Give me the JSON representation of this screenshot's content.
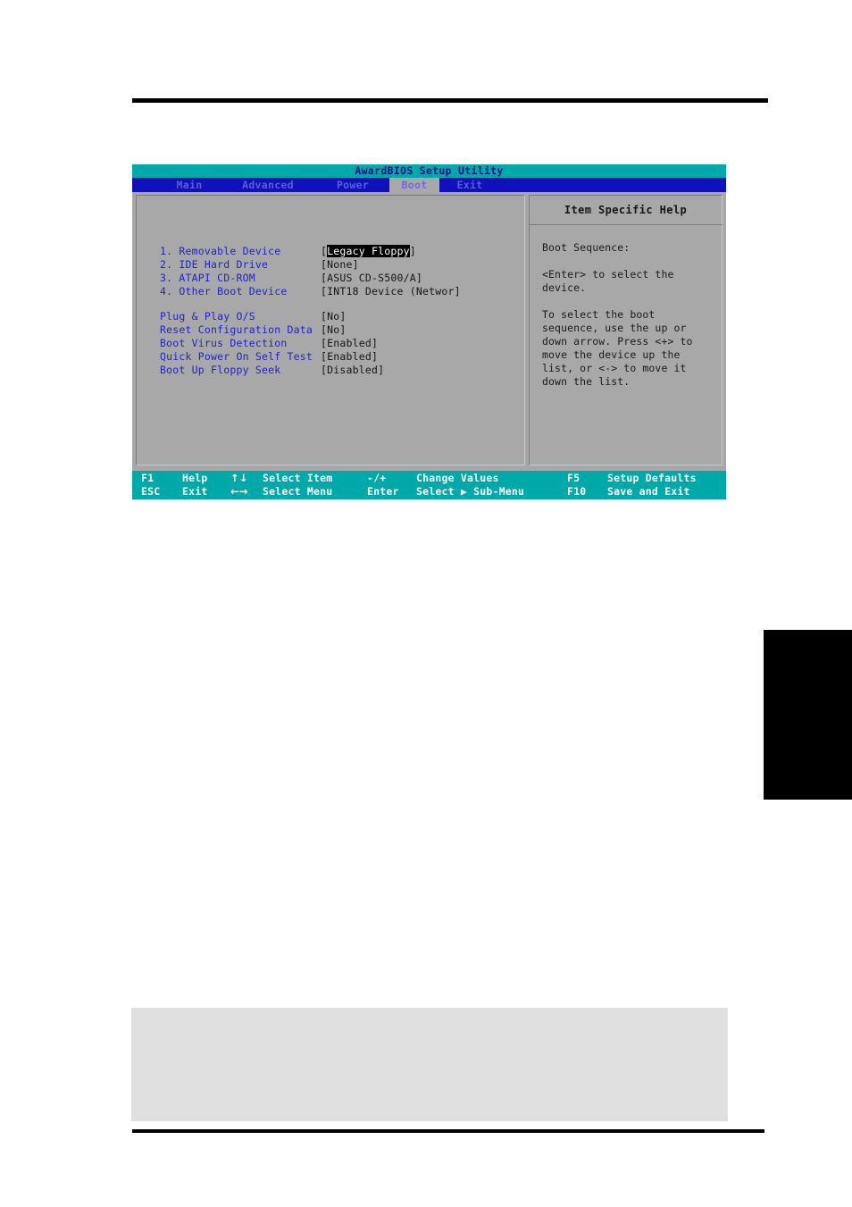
{
  "bios": {
    "title": "AwardBIOS Setup Utility",
    "tabs": [
      {
        "label": "Main",
        "active": false
      },
      {
        "label": "Advanced",
        "active": false
      },
      {
        "label": "Power",
        "active": false
      },
      {
        "label": "Boot",
        "active": true
      },
      {
        "label": "Exit",
        "active": false
      }
    ],
    "boot_sequence": [
      {
        "label": "1. Removable Device",
        "value_open": "[",
        "value_highlight": "Legacy Floppy",
        "value_plain": "",
        "value_close": "]"
      },
      {
        "label": "2. IDE Hard Drive",
        "value": "[None]"
      },
      {
        "label": "3. ATAPI CD-ROM",
        "value": "[ASUS CD-S500/A]"
      },
      {
        "label": "4. Other Boot Device",
        "value": "[INT18 Device (Networ]"
      }
    ],
    "settings": [
      {
        "label": "Plug & Play O/S",
        "value": "[No]"
      },
      {
        "label": "Reset Configuration Data",
        "value": "[No]"
      },
      {
        "label": "Boot Virus Detection",
        "value": "[Enabled]"
      },
      {
        "label": "Quick Power On Self Test",
        "value": "[Enabled]"
      },
      {
        "label": "Boot Up Floppy Seek",
        "value": "[Disabled]"
      }
    ],
    "help": {
      "header": "Item Specific Help",
      "lines": [
        "Boot Sequence:",
        "",
        "<Enter> to select the",
        "device.",
        "",
        "To select the boot",
        "sequence, use the up or",
        "down arrow. Press <+> to",
        "move the device up the",
        "list, or <-> to move it",
        "down the list."
      ]
    },
    "legend": {
      "row1": {
        "key1": "F1",
        "action1": "Help",
        "key2": "↑↓",
        "action2": "Select Item",
        "key3": "-/+",
        "action3": "Change Values",
        "key4": "F5",
        "action4": "Setup Defaults"
      },
      "row2": {
        "key1": "ESC",
        "action1": "Exit",
        "key2": "←→",
        "action2": "Select Menu",
        "key3": "Enter",
        "action3": "Select ▶ Sub-Menu",
        "key4": "F10",
        "action4": "Save and Exit"
      }
    },
    "colors": {
      "title_bar": "#00a9a9",
      "menu_bar": "#1111bb",
      "panel": "#a8a8a8",
      "label_text": "#2222cc",
      "legend_bar": "#00a9a9"
    }
  }
}
